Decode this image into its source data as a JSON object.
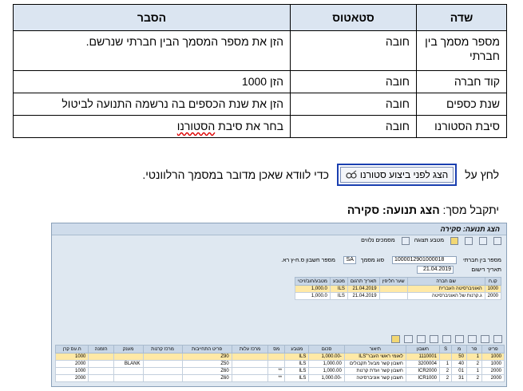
{
  "table": {
    "headers": [
      "שדה",
      "סטאטוס",
      "הסבר"
    ],
    "rows": [
      {
        "field": "מספר מסמך בין חברתי",
        "status": "חובה",
        "explain": "הזן את מספר המסמך הבין חברתי שנרשם."
      },
      {
        "field": "קוד חברה",
        "status": "חובה",
        "explain": "הזן 1000"
      },
      {
        "field": "שנת כספים",
        "status": "חובה",
        "explain": "הזן את שנת הכספים בה נרשמה התנועה לביטול"
      },
      {
        "field": "סיבת הסטורנו",
        "status": "חובה",
        "explain_pre": "בחר את סיבת ",
        "explain_squig": "הסטורנו"
      }
    ]
  },
  "para1": {
    "pre": "לחץ על",
    "button_label": "הצג לפני ביצוע סטורנו",
    "post": "כדי לוודא שאכן מדובר במסמך הרלוונטי."
  },
  "para2": {
    "pre": "יתקבל מסך: ",
    "bold": "הצג תנועה: סקירה"
  },
  "sap": {
    "title": "הצג תנועה: סקירה",
    "toolbar": [
      "מטבע תצוגה",
      "מסמכים נלווים"
    ],
    "doc_label": "מספר בין חברתי",
    "doc_value": "1000012901000018",
    "post_date_label": "תאריך רישום",
    "post_date_value": "21.04.2019",
    "doc_type_label": "סוג מסמך",
    "doc_type_value": "SA",
    "ref_label": "מספר חשבון ס.ח-ץ רא.",
    "companies_headers": [
      "קו.ח",
      "שם חברה",
      "שער חליפין",
      "תאריך תרגום",
      "מטבע",
      "מטבע/חוב/זיכוי"
    ],
    "companies": [
      [
        "1000",
        "האוניברסיטה העברית",
        "",
        "21.04.2019",
        "ILS",
        "1,000.0"
      ],
      [
        "2000",
        "ג.קרנות של האוניברסיטה",
        "",
        "21.04.2019",
        "ILS",
        "1,000.0"
      ]
    ],
    "lines_headers": [
      "פריט",
      "פר",
      "מ",
      "S",
      "חשבון",
      "תיאור",
      "סכום",
      "מטבע",
      "מס",
      "מרכז עלות",
      "פריט התחייבות",
      "מרכז קרנות",
      "מענק",
      "הזמנה",
      "ח.עס קרן"
    ],
    "lines": [
      [
        "1000",
        "1",
        "50",
        "",
        "1110001",
        "לאומי ראשי העבר\"ILS",
        "-1,000.00",
        "ILS",
        "",
        "",
        "Z90",
        "",
        "",
        "",
        "1000"
      ],
      [
        "1000",
        "2",
        "40",
        "1",
        "3200004",
        "חשבון קשר מבעל תקבולים",
        "1,000.00",
        "ILS",
        "",
        "",
        "Z50",
        "",
        "BLANK",
        "",
        "2000"
      ],
      [
        "2000",
        "1",
        "01",
        "2",
        "ICR2000",
        "חשבון קשר ועדת קרנות",
        "1,000.00",
        "ILS",
        "**",
        "",
        "Z60",
        "",
        "",
        "",
        "1000"
      ],
      [
        "2000",
        "2",
        "31",
        "2",
        "ICR1000",
        "חשבון קשר אוניברסיטה",
        "-1,000.00",
        "ILS",
        "**",
        "",
        "Z60",
        "",
        "",
        "",
        "2000"
      ]
    ]
  }
}
